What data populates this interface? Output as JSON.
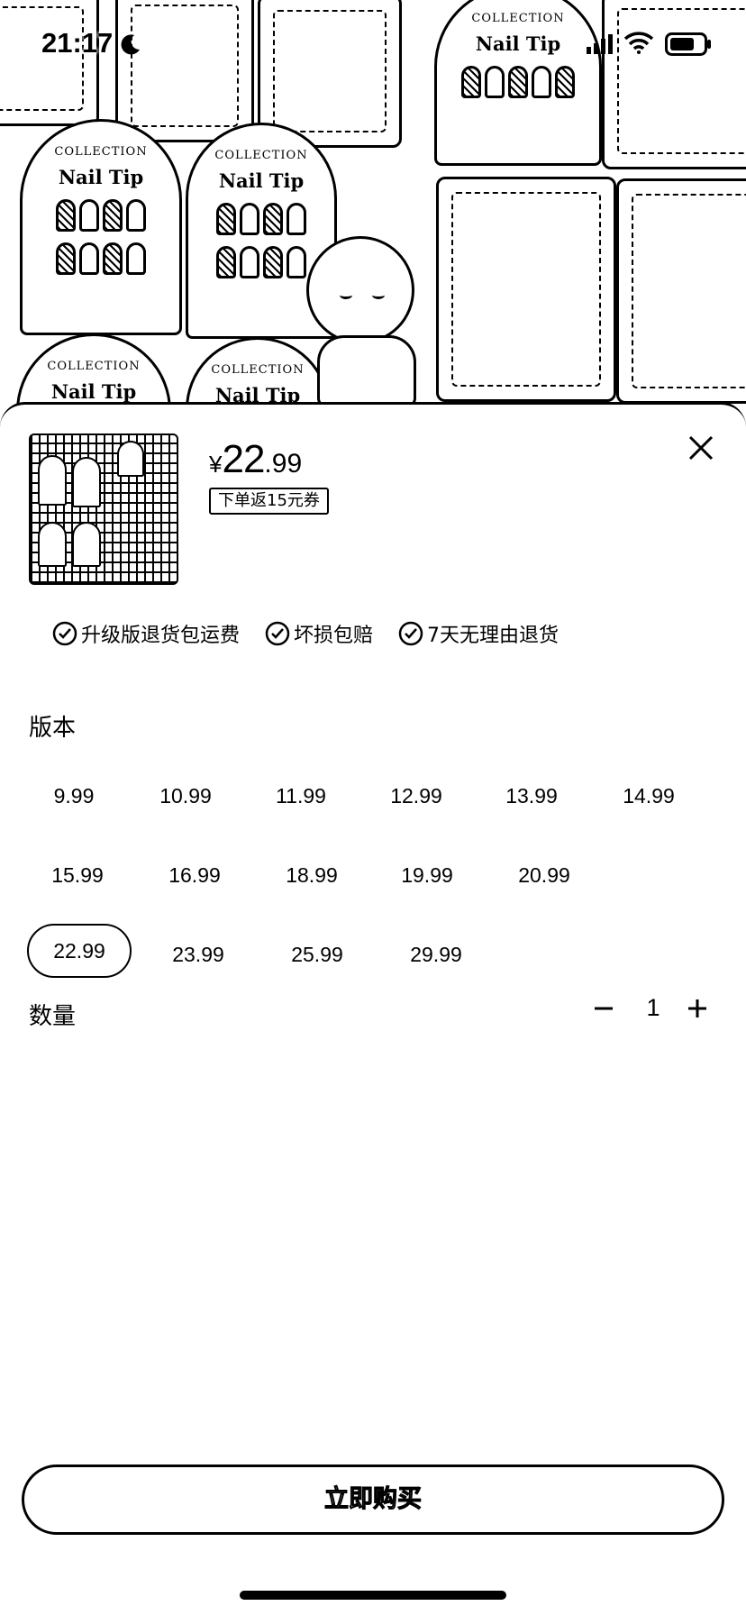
{
  "status_bar": {
    "time": "21:17",
    "icons": [
      "moon-icon",
      "signal-icon",
      "wifi-icon",
      "battery-icon"
    ]
  },
  "hero": {
    "card_collection_text": "COLLECTION",
    "card_title": "Nail Tip"
  },
  "product": {
    "price_currency": "¥",
    "price_integer": "22",
    "price_decimal": ".99",
    "coupon_text": "下单返15元券"
  },
  "guarantees": [
    {
      "label": "升级版退货包运费",
      "icon": "check-circle-icon"
    },
    {
      "label": "坏损包赔",
      "icon": "check-circle-icon"
    },
    {
      "label": "7天无理由退货",
      "icon": "check-circle-icon"
    }
  ],
  "version": {
    "label": "版本",
    "options": [
      "9.99",
      "10.99",
      "11.99",
      "12.99",
      "13.99",
      "14.99",
      "15.99",
      "16.99",
      "18.99",
      "19.99",
      "20.99",
      "22.99",
      "23.99",
      "25.99",
      "29.99"
    ],
    "selected": "22.99"
  },
  "quantity": {
    "label": "数量",
    "value": "1"
  },
  "buy_button": {
    "label": "立即购买"
  },
  "colors": {
    "ink": "#000000",
    "background": "#ffffff"
  }
}
